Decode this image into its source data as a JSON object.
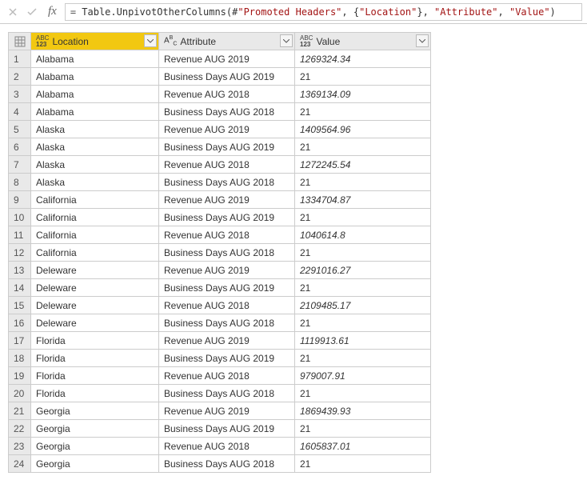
{
  "formula": {
    "eq": "= ",
    "fn": "Table.UnpivotOtherColumns",
    "open": "(#",
    "arg1": "\"Promoted Headers\"",
    "comma1": ", {",
    "arg2": "\"Location\"",
    "close1": "}, ",
    "arg3": "\"Attribute\"",
    "comma2": ", ",
    "arg4": "\"Value\"",
    "close2": ")"
  },
  "columns": {
    "c1": {
      "label": "Location",
      "type": "any"
    },
    "c2": {
      "label": "Attribute",
      "type": "text"
    },
    "c3": {
      "label": "Value",
      "type": "any"
    }
  },
  "chart_data": {
    "type": "table",
    "columns": [
      "Location",
      "Attribute",
      "Value"
    ],
    "rows": [
      {
        "n": "1",
        "loc": "Alabama",
        "attr": "Revenue AUG 2019",
        "val": "1269324.34",
        "italic": true
      },
      {
        "n": "2",
        "loc": "Alabama",
        "attr": "Business Days AUG 2019",
        "val": "21",
        "italic": false
      },
      {
        "n": "3",
        "loc": "Alabama",
        "attr": "Revenue AUG 2018",
        "val": "1369134.09",
        "italic": true
      },
      {
        "n": "4",
        "loc": "Alabama",
        "attr": "Business Days AUG 2018",
        "val": "21",
        "italic": false
      },
      {
        "n": "5",
        "loc": "Alaska",
        "attr": "Revenue AUG 2019",
        "val": "1409564.96",
        "italic": true
      },
      {
        "n": "6",
        "loc": "Alaska",
        "attr": "Business Days AUG 2019",
        "val": "21",
        "italic": false
      },
      {
        "n": "7",
        "loc": "Alaska",
        "attr": "Revenue AUG 2018",
        "val": "1272245.54",
        "italic": true
      },
      {
        "n": "8",
        "loc": "Alaska",
        "attr": "Business Days AUG 2018",
        "val": "21",
        "italic": false
      },
      {
        "n": "9",
        "loc": "California",
        "attr": "Revenue AUG 2019",
        "val": "1334704.87",
        "italic": true
      },
      {
        "n": "10",
        "loc": "California",
        "attr": "Business Days AUG 2019",
        "val": "21",
        "italic": false
      },
      {
        "n": "11",
        "loc": "California",
        "attr": "Revenue AUG 2018",
        "val": "1040614.8",
        "italic": true
      },
      {
        "n": "12",
        "loc": "California",
        "attr": "Business Days AUG 2018",
        "val": "21",
        "italic": false
      },
      {
        "n": "13",
        "loc": "Deleware",
        "attr": "Revenue AUG 2019",
        "val": "2291016.27",
        "italic": true
      },
      {
        "n": "14",
        "loc": "Deleware",
        "attr": "Business Days AUG 2019",
        "val": "21",
        "italic": false
      },
      {
        "n": "15",
        "loc": "Deleware",
        "attr": "Revenue AUG 2018",
        "val": "2109485.17",
        "italic": true
      },
      {
        "n": "16",
        "loc": "Deleware",
        "attr": "Business Days AUG 2018",
        "val": "21",
        "italic": false
      },
      {
        "n": "17",
        "loc": "Florida",
        "attr": "Revenue AUG 2019",
        "val": "1119913.61",
        "italic": true
      },
      {
        "n": "18",
        "loc": "Florida",
        "attr": "Business Days AUG 2019",
        "val": "21",
        "italic": false
      },
      {
        "n": "19",
        "loc": "Florida",
        "attr": "Revenue AUG 2018",
        "val": "979007.91",
        "italic": true
      },
      {
        "n": "20",
        "loc": "Florida",
        "attr": "Business Days AUG 2018",
        "val": "21",
        "italic": false
      },
      {
        "n": "21",
        "loc": "Georgia",
        "attr": "Revenue AUG 2019",
        "val": "1869439.93",
        "italic": true
      },
      {
        "n": "22",
        "loc": "Georgia",
        "attr": "Business Days AUG 2019",
        "val": "21",
        "italic": false
      },
      {
        "n": "23",
        "loc": "Georgia",
        "attr": "Revenue AUG 2018",
        "val": "1605837.01",
        "italic": true
      },
      {
        "n": "24",
        "loc": "Georgia",
        "attr": "Business Days AUG 2018",
        "val": "21",
        "italic": false
      }
    ]
  }
}
